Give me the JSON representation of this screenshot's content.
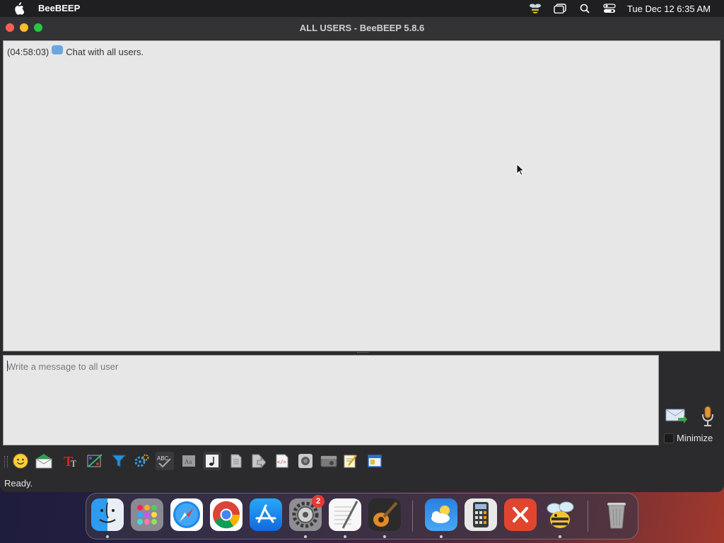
{
  "menubar": {
    "app_name": "BeeBEEP",
    "clock": "Tue Dec 12  6:35 AM",
    "icons": [
      "apple-icon",
      "beebeep-status-icon",
      "window-manager-icon",
      "spotlight-search-icon",
      "control-center-icon"
    ]
  },
  "window": {
    "title": "ALL USERS - BeeBEEP 5.8.6"
  },
  "chat": {
    "messages": [
      {
        "time": "(04:58:03)",
        "icon": "speech-bubble-icon",
        "text": "Chat with all users."
      }
    ]
  },
  "input": {
    "placeholder": "Write a message to all user",
    "value": ""
  },
  "side": {
    "minimize_label": "Minimize",
    "minimize_checked": false
  },
  "toolbar": {
    "buttons": [
      "emoticon-icon",
      "send-mail-icon",
      "text-format-icon",
      "color-picker-icon",
      "filter-icon",
      "settings-icon",
      "spellcheck-icon",
      "font-icon",
      "music-note-icon",
      "document-icon",
      "file-share-icon",
      "code-icon",
      "screenshot-icon",
      "screen-capture-icon",
      "notes-icon",
      "window-icon"
    ]
  },
  "status": {
    "text": "Ready."
  },
  "dock": {
    "items": [
      "Finder",
      "Launchpad",
      "Safari",
      "Chrome",
      "App Store",
      "System Settings",
      "TextEdit",
      "GarageBand",
      "Weather",
      "Calculator",
      "Remote Desktop",
      "BeeBEEP",
      "Trash"
    ],
    "system_settings_badge": "2"
  }
}
